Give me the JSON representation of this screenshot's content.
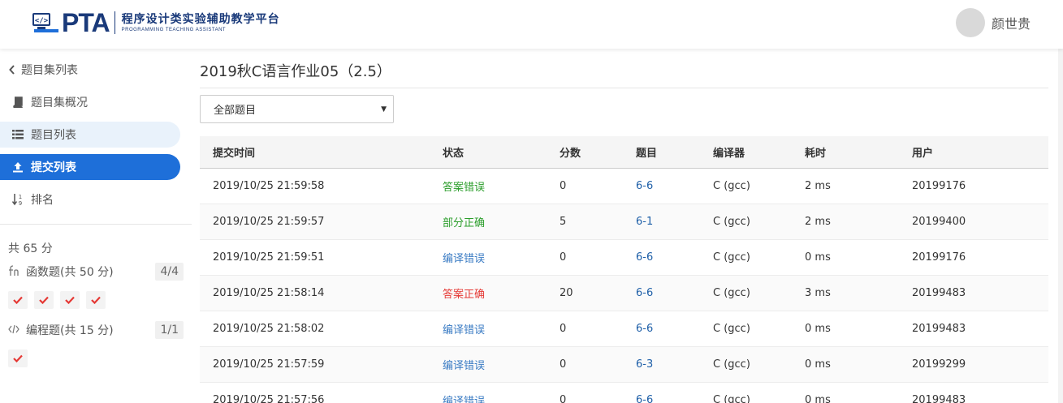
{
  "header": {
    "logo_text": "PTA",
    "logo_cn": "程序设计类实验辅助教学平台",
    "logo_en": "PROGRAMMING TEACHING ASSISTANT",
    "user_name": "颜世贵"
  },
  "sidebar": {
    "back_label": "题目集列表",
    "items": [
      {
        "label": "题目集概况",
        "icon": "book-icon"
      },
      {
        "label": "题目列表",
        "icon": "list-icon"
      },
      {
        "label": "提交列表",
        "icon": "upload-icon"
      },
      {
        "label": "排名",
        "icon": "sort-icon"
      }
    ],
    "total": "共 65 分",
    "categories": [
      {
        "label": "函数题(共 50 分)",
        "count": "4/4",
        "icon": "function-icon"
      },
      {
        "label": "编程题(共 15 分)",
        "count": "1/1",
        "icon": "code-icon"
      }
    ]
  },
  "main": {
    "title": "2019秋C语言作业05（2.5）",
    "filter_value": "全部题目",
    "columns": [
      "提交时间",
      "状态",
      "分数",
      "题目",
      "编译器",
      "耗时",
      "用户"
    ],
    "rows": [
      {
        "time": "2019/10/25 21:59:58",
        "status": "答案错误",
        "score": "0",
        "problem": "6-6",
        "compiler": "C (gcc)",
        "duration": "2 ms",
        "user": "20199176"
      },
      {
        "time": "2019/10/25 21:59:57",
        "status": "部分正确",
        "score": "5",
        "problem": "6-1",
        "compiler": "C (gcc)",
        "duration": "2 ms",
        "user": "20199400"
      },
      {
        "time": "2019/10/25 21:59:51",
        "status": "编译错误",
        "score": "0",
        "problem": "6-6",
        "compiler": "C (gcc)",
        "duration": "0 ms",
        "user": "20199176"
      },
      {
        "time": "2019/10/25 21:58:14",
        "status": "答案正确",
        "score": "20",
        "problem": "6-6",
        "compiler": "C (gcc)",
        "duration": "3 ms",
        "user": "20199483"
      },
      {
        "time": "2019/10/25 21:58:02",
        "status": "编译错误",
        "score": "0",
        "problem": "6-6",
        "compiler": "C (gcc)",
        "duration": "0 ms",
        "user": "20199483"
      },
      {
        "time": "2019/10/25 21:57:59",
        "status": "编译错误",
        "score": "0",
        "problem": "6-3",
        "compiler": "C (gcc)",
        "duration": "0 ms",
        "user": "20199299"
      },
      {
        "time": "2019/10/25 21:57:56",
        "status": "编译错误",
        "score": "0",
        "problem": "6-6",
        "compiler": "C (gcc)",
        "duration": "0 ms",
        "user": "20199483"
      }
    ]
  },
  "colors": {
    "accent": "#1e6fd9",
    "wrong": "#2a9d2a",
    "compile_error": "#3b7cc4",
    "correct": "#e53935"
  }
}
